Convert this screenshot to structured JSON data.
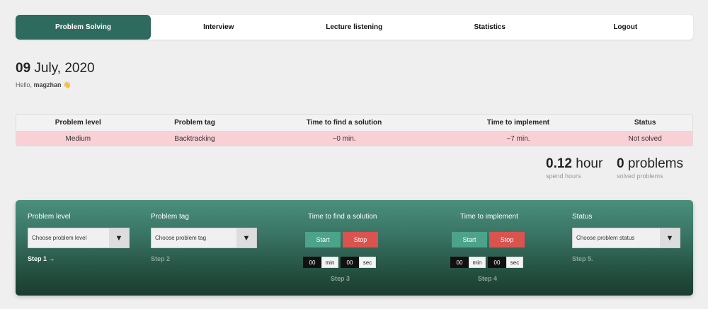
{
  "nav": {
    "items": [
      {
        "label": "Problem Solving"
      },
      {
        "label": "Interview"
      },
      {
        "label": "Lecture listening"
      },
      {
        "label": "Statistics"
      },
      {
        "label": "Logout"
      }
    ]
  },
  "header": {
    "day": "09",
    "month_year": "July, 2020",
    "hello_prefix": "Hello,",
    "username": "magzhan",
    "wave": "👋"
  },
  "table": {
    "headers": [
      "Problem level",
      "Problem tag",
      "Time to find a solution",
      "Time to implement",
      "Status"
    ],
    "rows": [
      [
        "Medium",
        "Backtracking",
        "~0 min.",
        "~7 min.",
        "Not solved"
      ]
    ]
  },
  "stats": {
    "hours_value": "0.12",
    "hours_unit": "hour",
    "hours_caption": "spend hours",
    "problems_value": "0",
    "problems_unit": "problems",
    "problems_caption": "solved problems"
  },
  "form": {
    "level": {
      "title": "Problem level",
      "placeholder": "Choose problem level",
      "step": "Step 1 →"
    },
    "tag": {
      "title": "Problem tag",
      "placeholder": "Choose problem tag",
      "step": "Step 2"
    },
    "find": {
      "title": "Time to find a solution",
      "start": "Start",
      "stop": "Stop",
      "min_value": "00",
      "min_unit": "min",
      "sec_value": "00",
      "sec_unit": "sec",
      "step": "Step 3"
    },
    "implement": {
      "title": "Time to implement",
      "start": "Start",
      "stop": "Stop",
      "min_value": "00",
      "min_unit": "min",
      "sec_value": "00",
      "sec_unit": "sec",
      "step": "Step 4"
    },
    "status": {
      "title": "Status",
      "placeholder": "Choose problem status",
      "step": "Step 5."
    },
    "arrow": "▼"
  },
  "colors": {
    "accent": "#2e6b5e",
    "start": "#4ca38a",
    "stop": "#d9534f",
    "row_highlight": "#f8d0d6"
  }
}
